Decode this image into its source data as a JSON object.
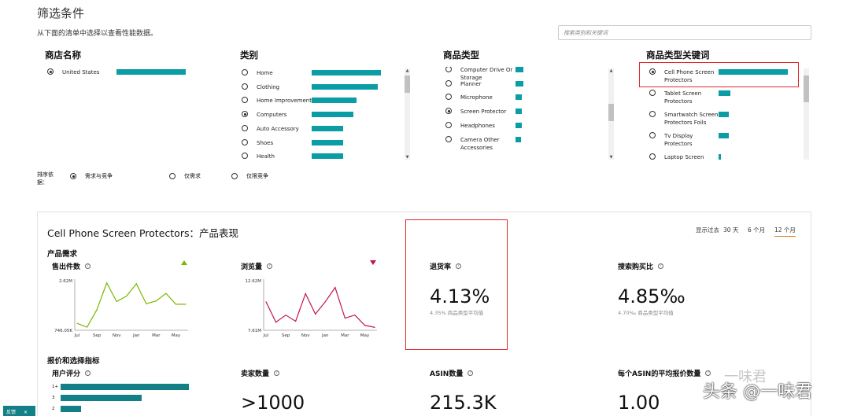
{
  "header": {
    "title": "筛选条件",
    "subtitle": "从下面的清单中选择以查看性能数据。",
    "search_placeholder": "搜索类别和关键词"
  },
  "columns": {
    "store": {
      "heading": "商店名称",
      "items": [
        {
          "label": "United States",
          "selected": true,
          "share": 1.0
        }
      ]
    },
    "category": {
      "heading": "类别",
      "items": [
        {
          "label": "Home",
          "selected": false,
          "share": 1.0
        },
        {
          "label": "Clothing",
          "selected": false,
          "share": 0.95
        },
        {
          "label": "Home Improvement",
          "selected": false,
          "share": 0.65
        },
        {
          "label": "Computers",
          "selected": true,
          "share": 0.6
        },
        {
          "label": "Auto Accessory",
          "selected": false,
          "share": 0.46
        },
        {
          "label": "Shoes",
          "selected": false,
          "share": 0.46
        },
        {
          "label": "Health",
          "selected": false,
          "share": 0.46
        }
      ]
    },
    "product_type": {
      "heading": "商品类型",
      "items": [
        {
          "label": "Computer Drive Or Storage",
          "selected": false,
          "share": 0.12
        },
        {
          "label": "Planner",
          "selected": false,
          "share": 0.12
        },
        {
          "label": "Microphone",
          "selected": false,
          "share": 0.1
        },
        {
          "label": "Screen Protector",
          "selected": true,
          "share": 0.1
        },
        {
          "label": "Headphones",
          "selected": false,
          "share": 0.1
        },
        {
          "label": "Camera Other Accessories",
          "selected": false,
          "share": 0.09
        }
      ]
    },
    "keyword": {
      "heading": "商品类型关键词",
      "items": [
        {
          "label": "Cell Phone Screen Protectors",
          "selected": true,
          "share": 1.0
        },
        {
          "label": "Tablet Screen Protectors",
          "selected": false,
          "share": 0.17
        },
        {
          "label": "Smartwatch Screen Protectors Foils",
          "selected": false,
          "share": 0.15
        },
        {
          "label": "Tv Display Protectors",
          "selected": false,
          "share": 0.15
        },
        {
          "label": "Laptop Screen",
          "selected": false,
          "share": 0.03
        }
      ]
    }
  },
  "sort": {
    "label": "排序依据：",
    "options": [
      {
        "label": "需求与竞争",
        "selected": true
      },
      {
        "label": "仅需求",
        "selected": false
      },
      {
        "label": "仅限竞争",
        "selected": false
      }
    ]
  },
  "panel": {
    "title": "Cell Phone Screen Protectors：产品表现",
    "period_label": "显示过去",
    "periods": [
      {
        "label": "30 天",
        "selected": false
      },
      {
        "label": "6 个月",
        "selected": false
      },
      {
        "label": "12 个月",
        "selected": true
      }
    ],
    "demand_section": "产品需求",
    "pricing_section": "报价和选择指标",
    "units_sold": {
      "label": "售出件数",
      "trend": "up"
    },
    "page_views": {
      "label": "浏览量",
      "trend": "down"
    },
    "return_rate": {
      "label": "退货率",
      "value": "4.13%",
      "sub": "4.35% 商品类型平均值"
    },
    "search_ratio": {
      "label": "搜索购买比",
      "value": "4.85‰",
      "sub": "4.70‰ 商品类型平均值"
    },
    "rating": {
      "label": "用户评分",
      "bars": [
        {
          "label": "1+",
          "share": 1.0
        },
        {
          "label": "3",
          "share": 0.63
        },
        {
          "label": "2",
          "share": 0.16
        }
      ]
    },
    "sellers": {
      "label": "卖家数量",
      "value": ">1000"
    },
    "asins": {
      "label": "ASIN数量",
      "value": "215.3K"
    },
    "avg_offers": {
      "label": "每个ASIN的平均报价数量",
      "value": "1.00"
    }
  },
  "chart_data": [
    {
      "type": "line",
      "title": "售出件数",
      "x": [
        "Jul",
        "Aug",
        "Sep",
        "Oct",
        "Nov",
        "Dec",
        "Jan",
        "Feb",
        "Mar",
        "Apr",
        "May",
        "Jun"
      ],
      "tick_labels": [
        "Jul",
        "Sep",
        "Nov",
        "Jan",
        "Mar",
        "May"
      ],
      "y_tick_labels": [
        "2.62M",
        "746.05K"
      ],
      "ylim": [
        746050,
        2620000
      ],
      "values": [
        1000000,
        860000,
        1500000,
        2480000,
        1800000,
        2000000,
        2450000,
        1720000,
        1820000,
        2100000,
        1700000,
        1700000
      ],
      "color": "#7ab800"
    },
    {
      "type": "line",
      "title": "浏览量",
      "x": [
        "Jul",
        "Aug",
        "Sep",
        "Oct",
        "Nov",
        "Dec",
        "Jan",
        "Feb",
        "Mar",
        "Apr",
        "May",
        "Jun"
      ],
      "tick_labels": [
        "Jul",
        "Sep",
        "Nov",
        "Jan",
        "Mar",
        "May"
      ],
      "y_tick_labels": [
        "12.62M",
        "7.61M"
      ],
      "ylim": [
        7610000,
        12620000
      ],
      "values": [
        10400000,
        8400000,
        9100000,
        8500000,
        11200000,
        9200000,
        10400000,
        11800000,
        8800000,
        9100000,
        8100000,
        7900000
      ],
      "color": "#c0184a"
    }
  ],
  "feedback": "反馈",
  "watermark": {
    "line1": "一味君",
    "line2": "头条 @一味君"
  }
}
